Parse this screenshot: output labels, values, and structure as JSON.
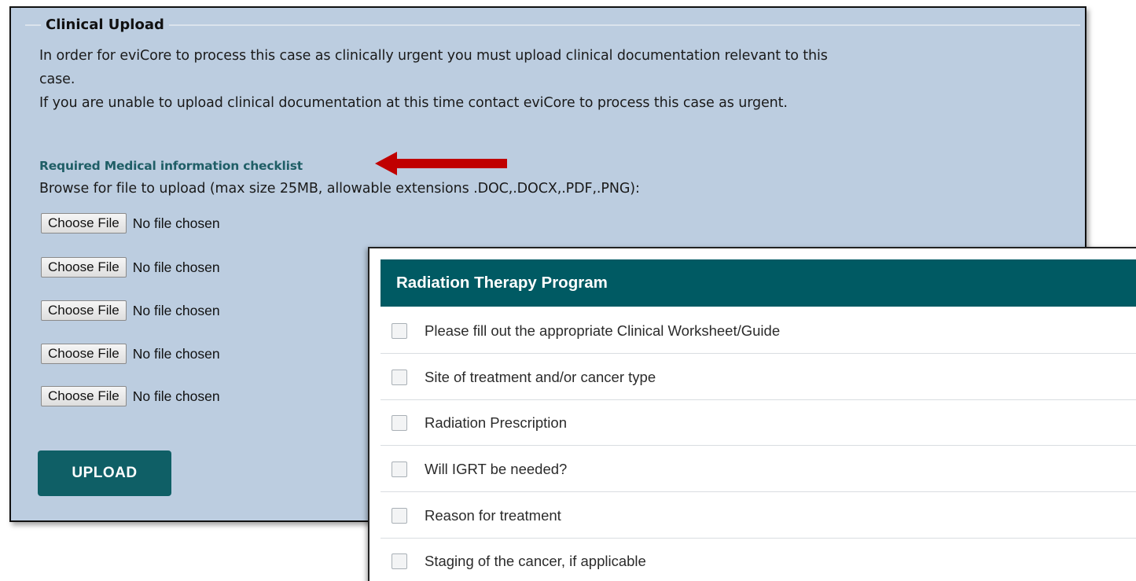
{
  "clinical_upload": {
    "legend": "Clinical Upload",
    "intro_line_1": "In order for eviCore to process this case as clinically urgent you must upload clinical documentation relevant to this",
    "intro_line_2": "case.",
    "intro_line_3": "If you are unable to upload clinical documentation at this time contact eviCore to process this case as urgent.",
    "checklist_link": "Required Medical information checklist",
    "browse_instructions": "Browse for file to upload (max size 25MB, allowable extensions .DOC,.DOCX,.PDF,.PNG):",
    "file_inputs": [
      {
        "button": "Choose File",
        "status": "No file chosen"
      },
      {
        "button": "Choose File",
        "status": "No file chosen"
      },
      {
        "button": "Choose File",
        "status": "No file chosen"
      },
      {
        "button": "Choose File",
        "status": "No file chosen"
      },
      {
        "button": "Choose File",
        "status": "No file chosen"
      }
    ],
    "upload_button": "UPLOAD"
  },
  "annotation": {
    "icon": "red-arrow-left-icon",
    "color": "#c00000"
  },
  "checklist": {
    "title": "Radiation Therapy Program",
    "items": [
      {
        "label": "Please fill out the appropriate Clinical Worksheet/Guide",
        "checked": false
      },
      {
        "label": "Site of treatment and/or cancer type",
        "checked": false
      },
      {
        "label": "Radiation Prescription",
        "checked": false
      },
      {
        "label": "Will IGRT be needed?",
        "checked": false
      },
      {
        "label": "Reason for treatment",
        "checked": false
      },
      {
        "label": "Staging of the cancer, if applicable",
        "checked": false
      }
    ]
  },
  "colors": {
    "panel_background": "#bccde0",
    "brand_teal": "#005a63",
    "link_teal": "#1f5e66"
  }
}
